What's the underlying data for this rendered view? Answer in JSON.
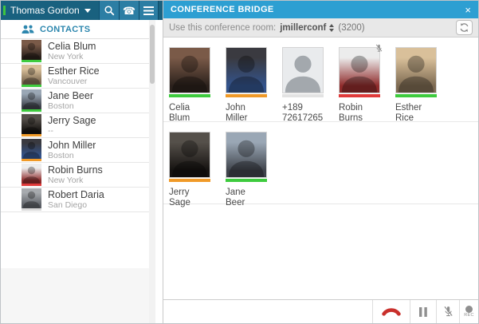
{
  "titlebar": {
    "user_name": "Thomas Gordon",
    "presence_color": "#3fc43f",
    "icons": [
      "search-icon",
      "dialpad-icon",
      "menu-icon"
    ]
  },
  "sidebar": {
    "title": "CONTACTS",
    "icon": "contacts-people-icon",
    "contacts": [
      {
        "name": "Celia Blum",
        "location": "New York",
        "status_color": "#3ecb3e",
        "avatar_top": "#7a5a48",
        "avatar_bottom": "#2b211c"
      },
      {
        "name": "Esther Rice",
        "location": "Vancouver",
        "status_color": "#3ecb3e",
        "avatar_top": "#d9c09a",
        "avatar_bottom": "#7d6a52"
      },
      {
        "name": "Jane Beer",
        "location": "Boston",
        "status_color": "#3ecb3e",
        "avatar_top": "#9aa7b5",
        "avatar_bottom": "#3f434b"
      },
      {
        "name": "Jerry Sage",
        "location": "--",
        "status_color": "#f09a28",
        "avatar_top": "#55504a",
        "avatar_bottom": "#151210"
      },
      {
        "name": "John Miller",
        "location": "Boston",
        "status_color": "#f09a28",
        "avatar_top": "#3a3a40",
        "avatar_bottom": "#33538c"
      },
      {
        "name": "Robin Burns",
        "location": "New York",
        "status_color": "#e03a3a",
        "avatar_top": "#ececec",
        "avatar_bottom": "#8f2b2b"
      },
      {
        "name": "Robert Daria",
        "location": "San Diego",
        "status_color": "#d9d9d9",
        "avatar_top": "#a7aaae",
        "avatar_bottom": "#5c6066"
      }
    ]
  },
  "conference": {
    "title": "CONFERENCE BRIDGE",
    "close_glyph": "×",
    "room_label": "Use this conference room:",
    "room_name": "jmillerconf",
    "room_extension": "(3200)",
    "refresh_icon": "refresh-icon",
    "participants": [
      {
        "row": 1,
        "line1": "Celia",
        "line2": "Blum",
        "status_color": "#3ecb3e",
        "muted": false,
        "placeholder": false,
        "avatar_top": "#7a5a48",
        "avatar_bottom": "#2b211c"
      },
      {
        "row": 1,
        "line1": "John",
        "line2": "Miller",
        "status_color": "#f09a28",
        "muted": false,
        "placeholder": false,
        "avatar_top": "#3a3a40",
        "avatar_bottom": "#33538c"
      },
      {
        "row": 1,
        "line1": "+189",
        "line2": "72617265",
        "status_color": "#e3e3e3",
        "muted": false,
        "placeholder": true,
        "avatar_top": "#e9ebed",
        "avatar_bottom": "#e9ebed"
      },
      {
        "row": 1,
        "line1": "Robin",
        "line2": "Burns",
        "status_color": "#e03a3a",
        "muted": true,
        "placeholder": false,
        "avatar_top": "#ececec",
        "avatar_bottom": "#8f2b2b"
      },
      {
        "row": 1,
        "line1": "Esther",
        "line2": "Rice",
        "status_color": "#3ecb3e",
        "muted": false,
        "placeholder": false,
        "avatar_top": "#d9c09a",
        "avatar_bottom": "#7d6a52"
      },
      {
        "row": 2,
        "line1": "Jerry",
        "line2": "Sage",
        "status_color": "#f09a28",
        "muted": false,
        "placeholder": false,
        "avatar_top": "#55504a",
        "avatar_bottom": "#151210"
      },
      {
        "row": 2,
        "line1": "Jane",
        "line2": "Beer",
        "status_color": "#3ecb3e",
        "muted": false,
        "placeholder": false,
        "avatar_top": "#9aa7b5",
        "avatar_bottom": "#3f434b"
      }
    ],
    "toolbar": {
      "record_label": "REC",
      "buttons": [
        "hangup-call-icon",
        "hold-pause-icon",
        "mute-microphone-icon",
        "record-icon"
      ],
      "hangup_color": "#c9302c"
    }
  }
}
